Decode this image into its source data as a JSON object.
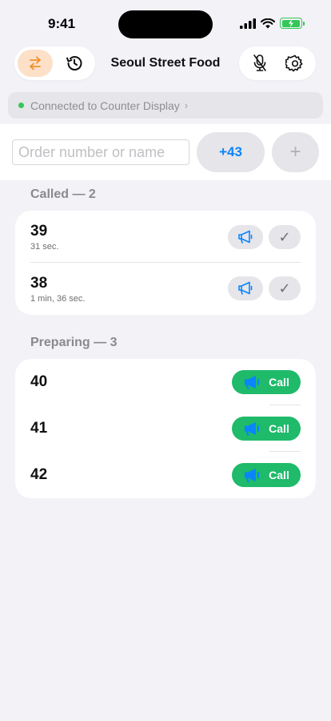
{
  "status_bar": {
    "time": "9:41"
  },
  "header": {
    "title": "Seoul Street Food"
  },
  "connection": {
    "text": "Connected to Counter Display",
    "chevron": "›"
  },
  "entry": {
    "placeholder": "Order number or name",
    "next_label": "+43",
    "add_label": "+"
  },
  "called": {
    "header": "Called — 2",
    "done_glyph": "✓",
    "orders": [
      {
        "number": "39",
        "time": "31 sec."
      },
      {
        "number": "38",
        "time": "1 min, 36 sec."
      }
    ]
  },
  "preparing": {
    "header": "Preparing — 3",
    "call_label": "Call",
    "orders": [
      {
        "number": "40"
      },
      {
        "number": "41"
      },
      {
        "number": "42"
      }
    ]
  },
  "colors": {
    "accent_orange": "#f0902c",
    "accent_blue": "#0a84ff",
    "call_green": "#1fba6a",
    "connection_green": "#34c759"
  }
}
